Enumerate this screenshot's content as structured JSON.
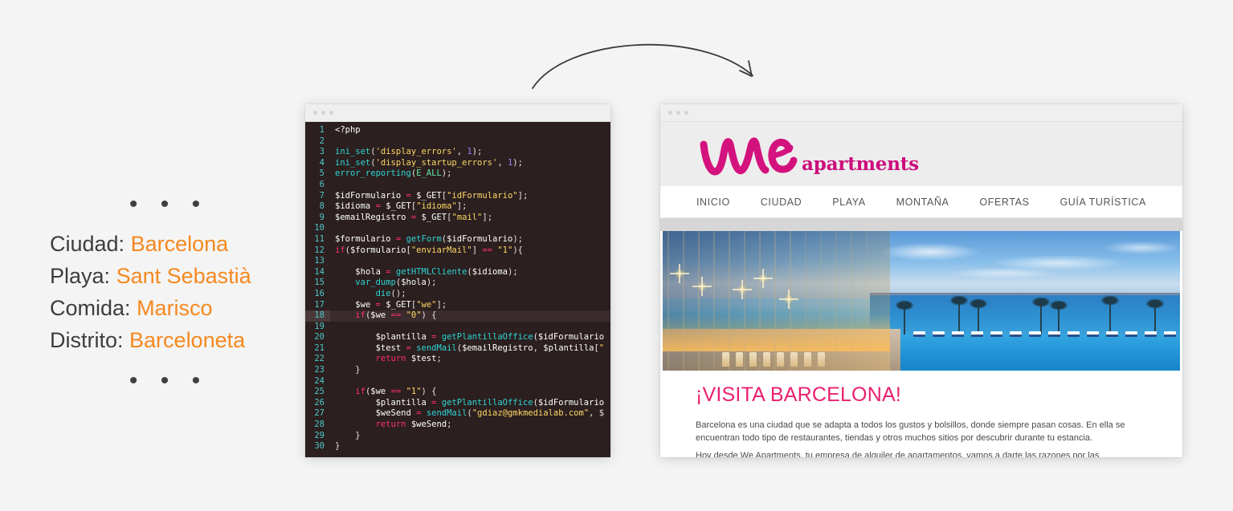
{
  "left_panel": {
    "dots_top": "• • •",
    "dots_bottom": "• • •",
    "accent_color": "#F5881F",
    "label_color": "#3d3d3d",
    "rows": [
      {
        "key": "Ciudad:",
        "value": "Barcelona"
      },
      {
        "key": "Playa:",
        "value": "Sant Sebastià"
      },
      {
        "key": "Comida:",
        "value": "Marisco"
      },
      {
        "key": "Distrito:",
        "value": "Barceloneta"
      }
    ]
  },
  "arrow": {
    "name": "curved-arrow",
    "direction": "left-to-right"
  },
  "code_window": {
    "titlebar_dots": 3,
    "language": "php",
    "background": "#2b1f1f",
    "line_number_color": "#4ec8c8",
    "highlighted_line": 18,
    "lines": [
      {
        "n": 1,
        "text": "<?php"
      },
      {
        "n": 2,
        "text": ""
      },
      {
        "n": 3,
        "text": "ini_set('display_errors', 1);"
      },
      {
        "n": 4,
        "text": "ini_set('display_startup_errors', 1);"
      },
      {
        "n": 5,
        "text": "error_reporting(E_ALL);"
      },
      {
        "n": 6,
        "text": ""
      },
      {
        "n": 7,
        "text": "$idFormulario = $_GET[\"idFormulario\"];"
      },
      {
        "n": 8,
        "text": "$idioma = $_GET[\"idioma\"];"
      },
      {
        "n": 9,
        "text": "$emailRegistro = $_GET[\"mail\"];"
      },
      {
        "n": 10,
        "text": ""
      },
      {
        "n": 11,
        "text": "$formulario = getForm($idFormulario);"
      },
      {
        "n": 12,
        "text": "if($formulario[\"enviarMail\"] == \"1\"){"
      },
      {
        "n": 13,
        "text": ""
      },
      {
        "n": 14,
        "text": "    $hola = getHTMLCliente($idioma);"
      },
      {
        "n": 15,
        "text": "    var_dump($hola);"
      },
      {
        "n": 16,
        "text": "        die();"
      },
      {
        "n": 17,
        "text": "    $we = $_GET[\"we\"];"
      },
      {
        "n": 18,
        "text": "    if($we == \"0\") {"
      },
      {
        "n": 19,
        "text": ""
      },
      {
        "n": 20,
        "text": "        $plantilla = getPlantillaOffice($idFormulario"
      },
      {
        "n": 21,
        "text": "        $test = sendMail($emailRegistro, $plantilla[\""
      },
      {
        "n": 22,
        "text": "        return $test;"
      },
      {
        "n": 23,
        "text": "    }"
      },
      {
        "n": 24,
        "text": ""
      },
      {
        "n": 25,
        "text": "    if($we == \"1\") {"
      },
      {
        "n": 26,
        "text": "        $plantilla = getPlantillaOffice($idFormulario"
      },
      {
        "n": 27,
        "text": "        $weSend = sendMail(\"gdiaz@gmkmedialab.com\", $"
      },
      {
        "n": 28,
        "text": "        return $weSend;"
      },
      {
        "n": 29,
        "text": "    }"
      },
      {
        "n": 30,
        "text": "}"
      }
    ]
  },
  "site_window": {
    "titlebar_dots": 3,
    "brand": {
      "logo_script": "we",
      "logo_word": "apartments",
      "color": "#CC0D7C"
    },
    "nav": {
      "items": [
        {
          "label": "INICIO"
        },
        {
          "label": "CIUDAD"
        },
        {
          "label": "PLAYA"
        },
        {
          "label": "MONTAÑA"
        },
        {
          "label": "OFERTAS"
        },
        {
          "label": "GUÍA TURÍSTICA"
        }
      ]
    },
    "hero": {
      "alt": "Rooftop pool at dusk overlooking Barceloneta beach and the sea",
      "name": "hero-image"
    },
    "article": {
      "title": "¡VISITA BARCELONA!",
      "title_color": "#EA2070",
      "paragraphs": [
        "Barcelona es una ciudad que se adapta a todos los gustos y bolsillos, donde siempre pasan cosas. En ella se encuentran todo tipo de restaurantes, tiendas y otros muchos sitios por descubrir durante tu estancia.",
        "Hoy desde We Apartments, tu empresa de alquiler de apartamentos, vamos a darte las razones por las"
      ]
    }
  }
}
